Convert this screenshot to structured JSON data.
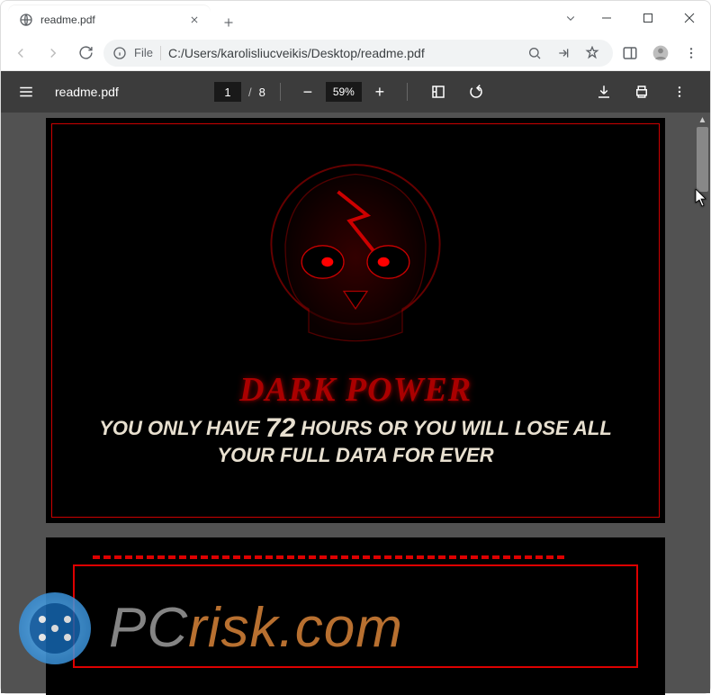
{
  "tab": {
    "title": "readme.pdf"
  },
  "address": {
    "file_label": "File",
    "path": "C:/Users/karolisliucveikis/Desktop/readme.pdf"
  },
  "pdf_toolbar": {
    "filename": "readme.pdf",
    "current_page": "1",
    "total_pages": "8",
    "zoom": "59%"
  },
  "document": {
    "title": "DARK POWER",
    "warning_line1_pre": "YOU ONLY HAVE ",
    "warning_hours": "72",
    "warning_line1_post": " HOURS OR YOU WILL LOSE ALL",
    "warning_line2": "YOUR FULL DATA FOR EVER"
  },
  "watermark": {
    "brand_pc": "PC",
    "brand_rest": "risk.com"
  }
}
